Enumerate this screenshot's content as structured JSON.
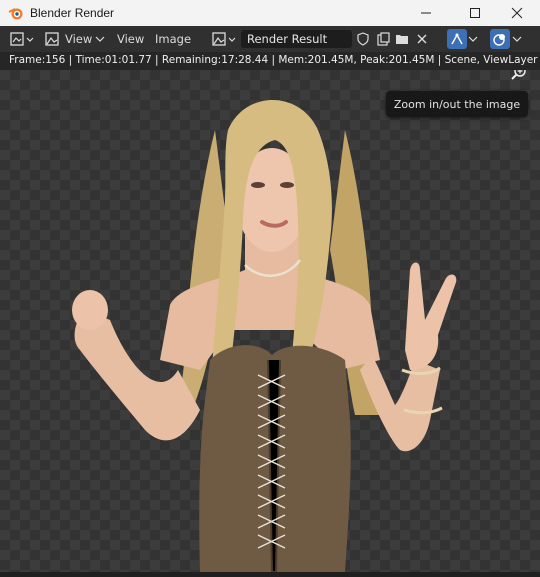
{
  "window": {
    "title": "Blender Render",
    "minimize_icon": "minimize-icon",
    "maximize_icon": "maximize-icon",
    "close_icon": "close-icon"
  },
  "toolbar": {
    "view_menu_label": "View",
    "view_label": "View",
    "image_label": "Image",
    "image_name": "Render Result",
    "icons": [
      "editor-type-icon",
      "image-mode-icon",
      "image-browse-icon",
      "fake-user-shield-icon",
      "new-image-icon",
      "open-folder-icon",
      "unlink-x-icon",
      "gizmo-icon",
      "overlay-icon"
    ]
  },
  "info": {
    "status": "Frame:156 | Time:01:01.77 | Remaining:17:28.44 | Mem:201.45M, Peak:201.45M | Scene, ViewLayer |"
  },
  "tooltip": {
    "text": "Zoom in/out the image"
  },
  "colors": {
    "accent": "#3d6fb4",
    "background": "#303030"
  }
}
